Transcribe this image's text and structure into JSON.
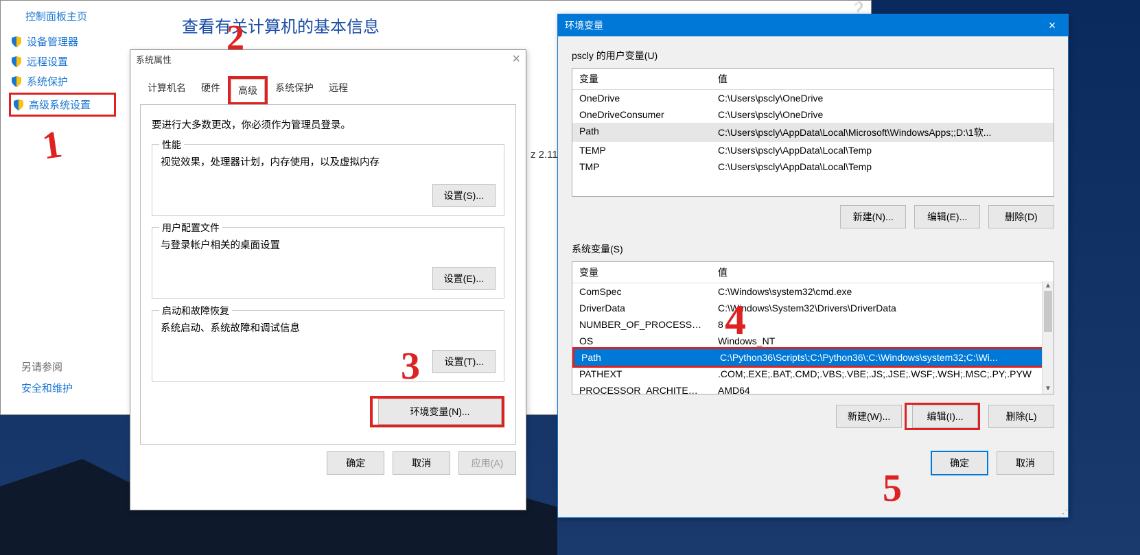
{
  "control_panel": {
    "home": "控制面板主页",
    "links": [
      "设备管理器",
      "远程设置",
      "系统保护",
      "高级系统设置"
    ],
    "title": "查看有关计算机的基本信息",
    "stray_text": "z  2.11",
    "see_also_header": "另请参阅",
    "see_also_link": "安全和维护"
  },
  "system_properties": {
    "title": "系统属性",
    "tabs": [
      "计算机名",
      "硬件",
      "高级",
      "系统保护",
      "远程"
    ],
    "intro": "要进行大多数更改，你必须作为管理员登录。",
    "groups": {
      "perf": {
        "title": "性能",
        "desc": "视觉效果，处理器计划，内存使用，以及虚拟内存",
        "btn": "设置(S)..."
      },
      "profile": {
        "title": "用户配置文件",
        "desc": "与登录帐户相关的桌面设置",
        "btn": "设置(E)..."
      },
      "startup": {
        "title": "启动和故障恢复",
        "desc": "系统启动、系统故障和调试信息",
        "btn": "设置(T)..."
      }
    },
    "env_btn": "环境变量(N)...",
    "ok": "确定",
    "cancel": "取消",
    "apply": "应用(A)"
  },
  "env_vars": {
    "title": "环境变量",
    "user_label": "pscly 的用户变量(U)",
    "col_var": "变量",
    "col_val": "值",
    "user_rows": [
      {
        "name": "OneDrive",
        "val": "C:\\Users\\pscly\\OneDrive"
      },
      {
        "name": "OneDriveConsumer",
        "val": "C:\\Users\\pscly\\OneDrive"
      },
      {
        "name": "Path",
        "val": "C:\\Users\\pscly\\AppData\\Local\\Microsoft\\WindowsApps;;D:\\1软..."
      },
      {
        "name": "TEMP",
        "val": "C:\\Users\\pscly\\AppData\\Local\\Temp"
      },
      {
        "name": "TMP",
        "val": "C:\\Users\\pscly\\AppData\\Local\\Temp"
      }
    ],
    "user_selected_index": 2,
    "btn_new_user": "新建(N)...",
    "btn_edit_user": "编辑(E)...",
    "btn_delete_user": "删除(D)",
    "sys_label": "系统变量(S)",
    "sys_rows": [
      {
        "name": "ComSpec",
        "val": "C:\\Windows\\system32\\cmd.exe"
      },
      {
        "name": "DriverData",
        "val": "C:\\Windows\\System32\\Drivers\\DriverData"
      },
      {
        "name": "NUMBER_OF_PROCESSORS",
        "val": "8"
      },
      {
        "name": "OS",
        "val": "Windows_NT"
      },
      {
        "name": "Path",
        "val": "C:\\Python36\\Scripts\\;C:\\Python36\\;C:\\Windows\\system32;C:\\Wi..."
      },
      {
        "name": "PATHEXT",
        "val": ".COM;.EXE;.BAT;.CMD;.VBS;.VBE;.JS;.JSE;.WSF;.WSH;.MSC;.PY;.PYW"
      },
      {
        "name": "PROCESSOR_ARCHITECTURE",
        "val": "AMD64"
      }
    ],
    "sys_selected_index": 4,
    "btn_new_sys": "新建(W)...",
    "btn_edit_sys": "编辑(I)...",
    "btn_delete_sys": "删除(L)",
    "ok": "确定",
    "cancel": "取消"
  },
  "annotations": {
    "n1": "1",
    "n2": "2",
    "n3": "3",
    "n4": "4",
    "n5": "5"
  }
}
